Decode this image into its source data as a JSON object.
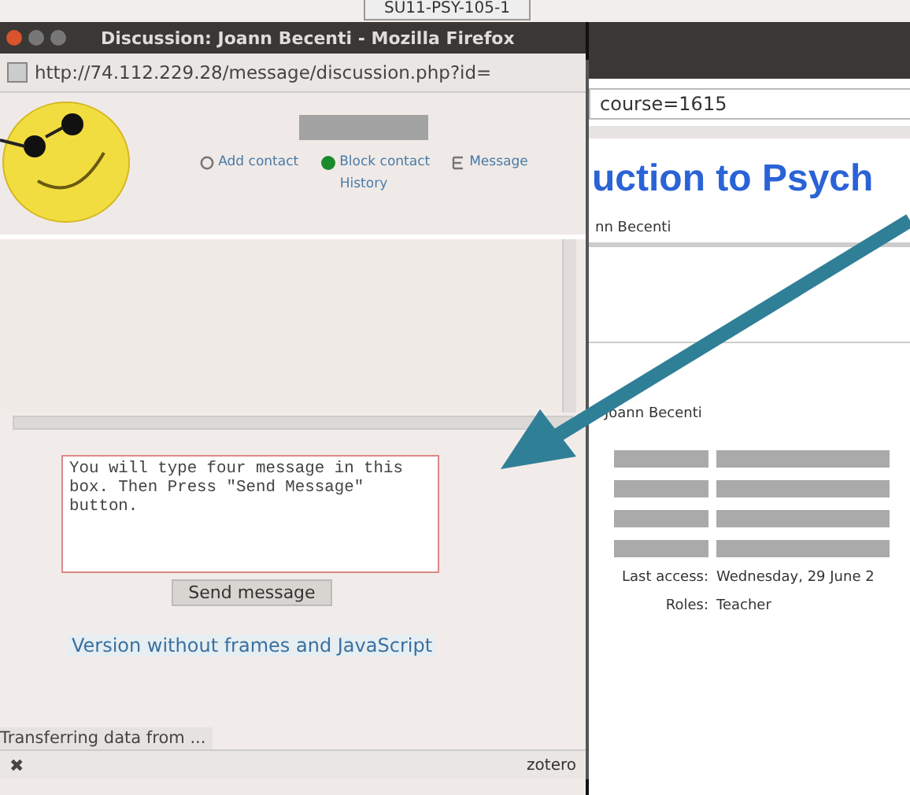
{
  "background_tab": {
    "label": "SU11-PSY-105-1"
  },
  "background_window": {
    "address_fragment": "course=1615",
    "heading": "uction to Psych",
    "subtitle": "nn Becenti",
    "profile_name": "Joann Becenti",
    "details": [
      {
        "label": "Last access:",
        "value": "Wednesday, 29 June 2"
      },
      {
        "label": "Roles:",
        "value": "Teacher"
      }
    ]
  },
  "popup": {
    "title": "Discussion: Joann Becenti - Mozilla Firefox",
    "address": "http://74.112.229.28/message/discussion.php?id=",
    "actions": [
      {
        "label": "Add contact",
        "kind": "add"
      },
      {
        "label": "Block contact",
        "kind": "block"
      },
      {
        "label": "Message",
        "kind": "message"
      }
    ],
    "history_link": "History",
    "message_value": "You will type four message in this box. Then Press \"Send Message\" button.",
    "send_button": "Send message",
    "no_frames_link": "Version without frames and JavaScript",
    "status": "Transferring data from ...",
    "close_glyph": "✖",
    "addon_label": "zotero"
  }
}
